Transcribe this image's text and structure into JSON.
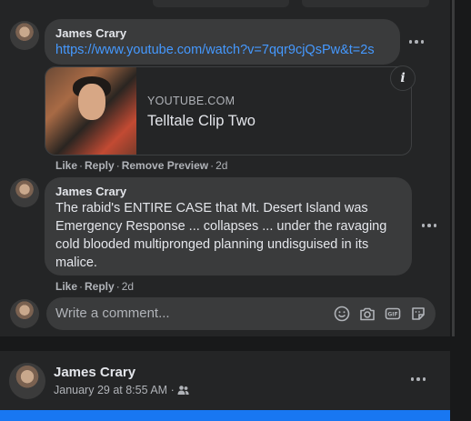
{
  "comments": [
    {
      "author": "James Crary",
      "link": "https://www.youtube.com/watch?v=7qqr9cjQsPw&t=2s",
      "preview": {
        "domain": "YOUTUBE.COM",
        "title": "Telltale Clip Two"
      },
      "actions": {
        "like": "Like",
        "reply": "Reply",
        "remove_preview": "Remove Preview",
        "age": "2d"
      }
    },
    {
      "author": "James Crary",
      "text_lines": [
        "The rabid's ENTIRE CASE that Mt. Desert Island was",
        "Emergency Response ... collapses ... under the ravaging",
        "cold blooded multipronged planning undisguised in its",
        "malice."
      ],
      "actions": {
        "like": "Like",
        "reply": "Reply",
        "age": "2d"
      }
    }
  ],
  "composer": {
    "placeholder": "Write a comment..."
  },
  "next_post": {
    "author": "James Crary",
    "time": "January 29 at 8:55 AM",
    "separator": "·"
  },
  "icons": {
    "info": "info-icon",
    "more": "more-horizontal-icon",
    "emoji": "emoji-icon",
    "camera": "camera-icon",
    "gif": "gif-icon",
    "sticker": "sticker-icon",
    "audience": "friends-audience-icon"
  },
  "colors": {
    "background": "#18191a",
    "card": "#242526",
    "bubble": "#3a3b3c",
    "link": "#4599ff",
    "text": "#e4e6eb",
    "secondary_text": "#b0b3b8",
    "accent": "#1877f2"
  }
}
